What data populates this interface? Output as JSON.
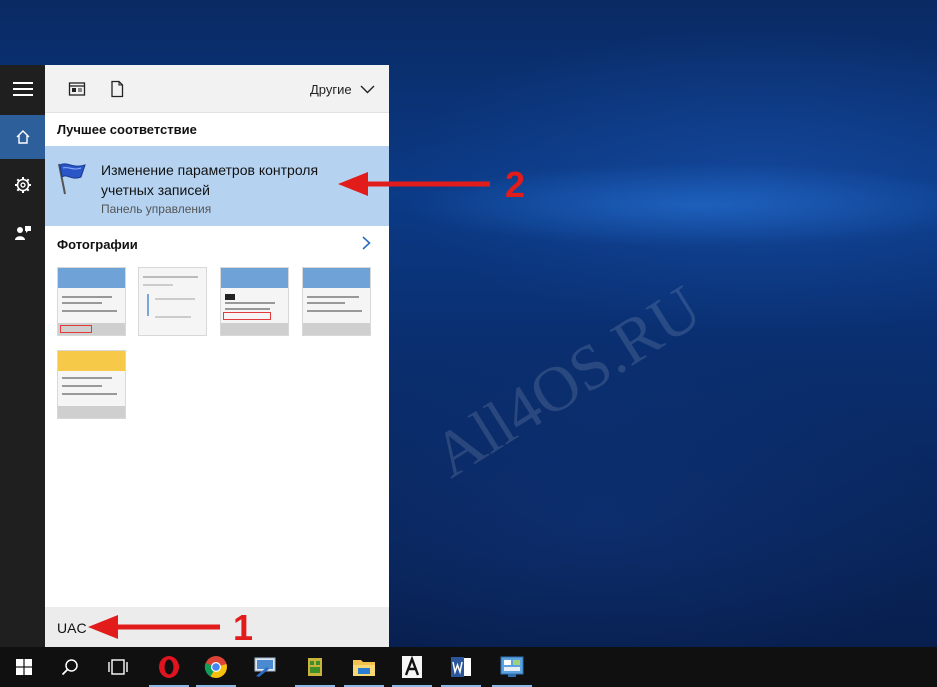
{
  "watermark": "All4OS.RU",
  "rail": {
    "menu_icon": "hamburger-icon",
    "home_icon": "home-icon",
    "settings_icon": "gear-icon",
    "feedback_icon": "feedback-icon"
  },
  "toolbar": {
    "apps_icon": "apps-filter-icon",
    "documents_icon": "document-icon",
    "more_label": "Другие"
  },
  "best_match": {
    "section_title": "Лучшее соответствие",
    "title": "Изменение параметров контроля учетных записей",
    "subtitle": "Панель управления",
    "icon": "uac-flag-icon"
  },
  "photos": {
    "section_title": "Фотографии",
    "items": [
      "thumbnail-1",
      "thumbnail-2",
      "thumbnail-3",
      "thumbnail-4",
      "thumbnail-5"
    ]
  },
  "search": {
    "query": "UAC"
  },
  "annotations": {
    "label_1": "1",
    "label_2": "2",
    "color": "#e21b1b"
  },
  "taskbar": {
    "apps": [
      "start-icon",
      "search-icon",
      "task-view-icon",
      "opera-icon",
      "chrome-icon",
      "remote-desktop-icon",
      "android-icon",
      "file-explorer-icon",
      "font-viewer-icon",
      "word-icon",
      "control-panel-icon"
    ]
  },
  "colors": {
    "accent": "#2d5f9a",
    "highlight": "#b5d3f1",
    "rail": "#1f1f1f",
    "taskbar": "#101010"
  }
}
